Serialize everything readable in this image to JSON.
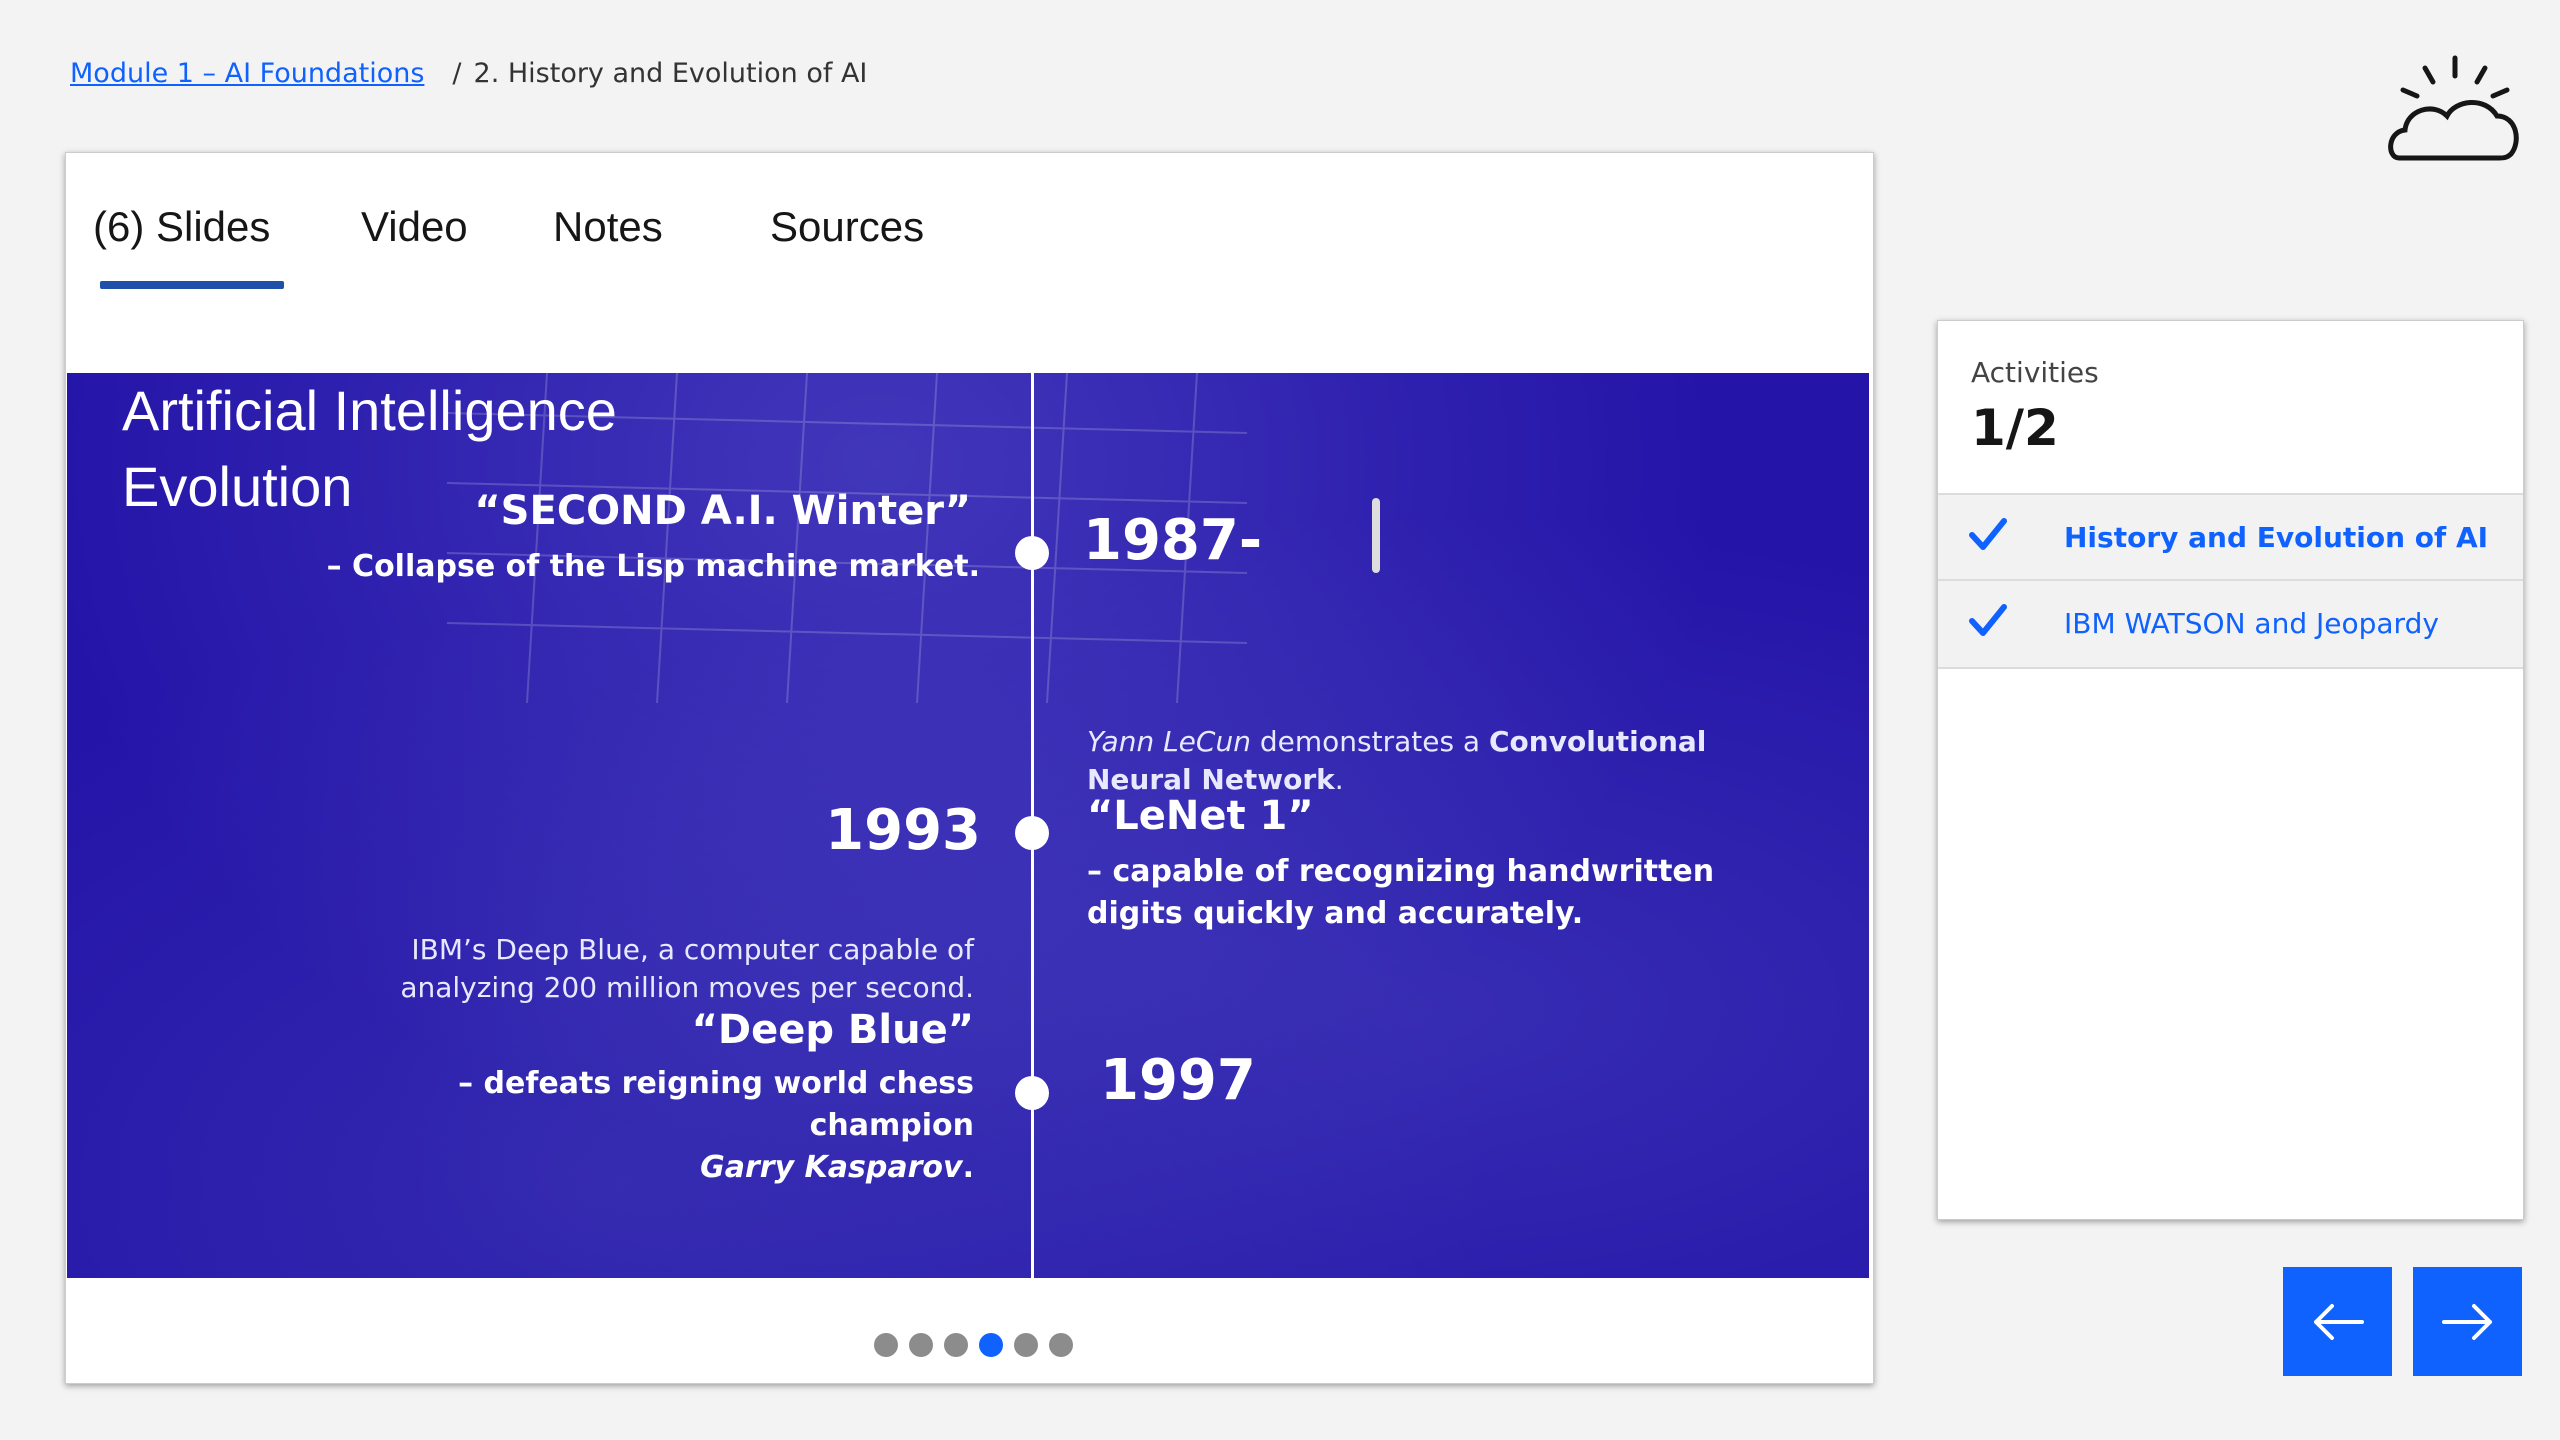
{
  "breadcrumb": {
    "parent": "Module 1 – AI Foundations",
    "separator": "/",
    "current": "2. History and Evolution of AI"
  },
  "tabs": [
    {
      "label": "(6) Slides",
      "active": true
    },
    {
      "label": "Video"
    },
    {
      "label": "Notes"
    },
    {
      "label": "Sources"
    }
  ],
  "slide": {
    "title_line1": "Artificial Intelligence",
    "title_line2": "Evolution",
    "e1987": {
      "year": "1987-",
      "headline": "“SECOND A.I. Winter”",
      "sub": "– Collapse of the Lisp machine market."
    },
    "e1993": {
      "year": "1993",
      "desc_italic": "Yann LeCun",
      "desc_mid": " demonstrates a ",
      "desc_bold": "Convolutional Neural Network",
      "desc_end": ".",
      "headline": "“LeNet 1”",
      "sub": "– capable of recognizing handwritten digits quickly and accurately."
    },
    "e1997": {
      "year": "1997",
      "desc": "IBM’s Deep Blue, a computer capable of analyzing 200 million moves per second.",
      "headline": "“Deep Blue”",
      "sub": "–  defeats reigning world chess champion",
      "sub_italic": "Garry Kasparov",
      "sub_end": "."
    }
  },
  "pager": {
    "count": 6,
    "active_index": 3
  },
  "activities": {
    "label": "Activities",
    "count": "1/2",
    "items": [
      {
        "label": "History and Evolution of AI",
        "completed": true,
        "current": true
      },
      {
        "label": "IBM WATSON and Jeopardy",
        "completed": true,
        "current": false
      }
    ]
  },
  "nav": {
    "prev_icon": "arrow-left-icon",
    "next_icon": "arrow-right-icon"
  },
  "colors": {
    "accent": "#0f62fe",
    "slide_bg": "#2414a8",
    "tab_underline": "#1f4fa8"
  },
  "logo_icon": "ibm-cloud-icon"
}
